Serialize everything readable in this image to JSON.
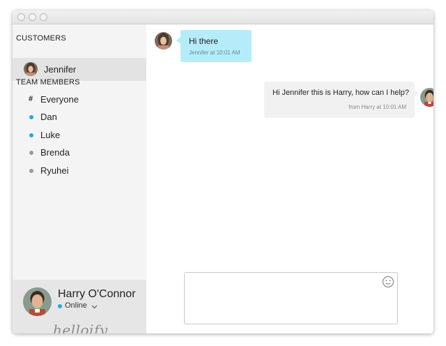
{
  "window": {
    "controls": [
      "close",
      "minimize",
      "zoom"
    ]
  },
  "sidebar": {
    "customers_heading": "CUSTOMERS",
    "customers": [
      {
        "name": "Jennifer"
      }
    ],
    "team_heading": "TEAM MEMBERS",
    "members": [
      {
        "name": "Everyone",
        "icon": "hash-icon"
      },
      {
        "name": "Dan",
        "status": "online",
        "status_color": "#19aee8"
      },
      {
        "name": "Luke",
        "status": "online",
        "status_color": "#19aee8"
      },
      {
        "name": "Brenda",
        "status": "offline",
        "status_color": "#9a9a9a"
      },
      {
        "name": "Ryuhei",
        "status": "offline",
        "status_color": "#9a9a9a"
      }
    ],
    "profile": {
      "name": "Harry O'Connor",
      "status": "Online",
      "status_color": "#19aee8"
    },
    "logo": "helloify"
  },
  "chat": {
    "messages": [
      {
        "from": "Jennifer",
        "text": "Hi there",
        "meta": "Jennifer at 10:01 AM",
        "bubble_color": "#b5ecf9"
      },
      {
        "from": "Harry",
        "text": "Hi Jennifer this is Harry, how can I help?",
        "meta": "from Harry at 10:01 AM",
        "bubble_color": "#f1f1f1"
      }
    ],
    "composer": {
      "placeholder": "",
      "emoji_icon": "smiley-icon"
    }
  }
}
